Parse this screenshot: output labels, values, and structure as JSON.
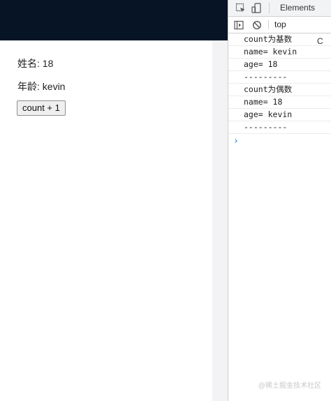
{
  "page": {
    "name_label": "姓名: 18",
    "age_label": "年龄: kevin",
    "count_button": "count + 1"
  },
  "devtools": {
    "tabs": [
      {
        "label": "Elements"
      },
      {
        "label": "C"
      }
    ],
    "context": "top",
    "console_logs": [
      "count为基数",
      "name= kevin",
      "age= 18",
      "---------",
      "count为偶数",
      "name= 18",
      "age= kevin",
      "---------"
    ],
    "prompt": "›"
  },
  "watermark": "@稀土掘金技术社区",
  "colors": {
    "header_bg": "#061425",
    "prompt_blue": "#1a73e8"
  }
}
